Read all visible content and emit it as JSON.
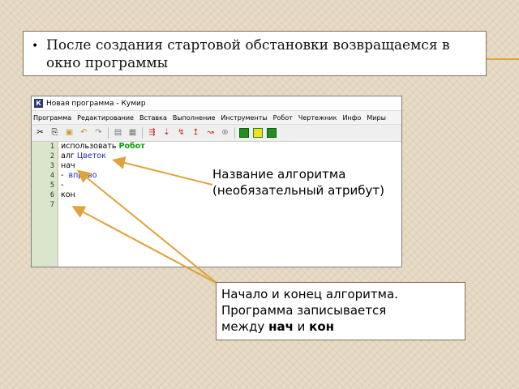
{
  "bullet": {
    "text": "После создания стартовой обстановки возвращаемся в окно программы"
  },
  "window": {
    "title": "Новая программа - Кумир",
    "app_icon_letter": "К",
    "menu": [
      "Программа",
      "Редактирование",
      "Вставка",
      "Выполнение",
      "Инструменты",
      "Робот",
      "Чертежник",
      "Инфо",
      "Миры"
    ],
    "toolbar_icons": [
      "cut-icon",
      "copy-icon",
      "paste-icon",
      "undo-icon",
      "redo-icon",
      "open-icon",
      "save-icon",
      "run-icon",
      "step-icon",
      "step-into-icon",
      "step-out-icon",
      "stop-icon",
      "grid-icon",
      "robot-icon",
      "field-icon"
    ],
    "line_numbers": [
      "1",
      "2",
      "3",
      "4",
      "5",
      "6",
      "7"
    ],
    "code": {
      "l1_kw": "использовать",
      "l1_mod": "Робот",
      "l2_kw": "алг",
      "l2_name": "Цветок",
      "l3": "нач",
      "l4_dash": "-",
      "l4_cmd": "вправо",
      "l5": "-",
      "l6": "кон",
      "l7": ""
    }
  },
  "annotation_name": {
    "line1": "Название алгоритма",
    "line2": "(необязательный атрибут)"
  },
  "annotation_begin_end": {
    "line1": "Начало и конец алгоритма.",
    "line2": "Программа записывается",
    "line3_pre": "между ",
    "kw_begin": "нач",
    "conj": " и ",
    "kw_end": "кон"
  },
  "colors": {
    "arrow": "#e0a23a",
    "keyword_green": "#00a000",
    "keyword_blue": "#1c2cb4",
    "gutter": "#d9e6cc"
  }
}
